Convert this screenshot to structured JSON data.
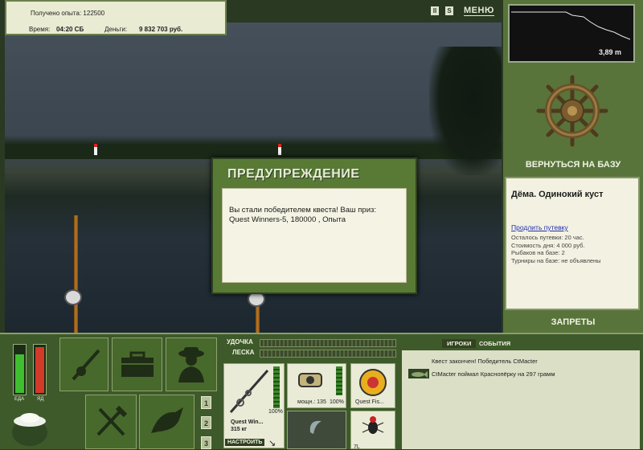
{
  "stats": {
    "experience_label": "Получено опыта:",
    "experience_value": "122500",
    "time_label": "Время:",
    "time_value": "04:20 СБ",
    "money_label": "Деньги:",
    "money_value": "9 832 703 руб."
  },
  "top_controls": {
    "pause_glyph": "II",
    "sound_glyph": "S",
    "menu_label": "МЕНЮ"
  },
  "depth": {
    "value": "3,89 m"
  },
  "base": {
    "return_label": "ВЕРНУТЬСЯ НА БАЗУ",
    "name": "Дёма. Одинокий куст",
    "extend_link": "Продлить путевку",
    "remaining": "Осталось путевки: 20 час.",
    "day_cost": "Стоимость дня: 4 000 руб.",
    "anglers": "Рыбаков на базе: 2",
    "tournaments": "Турниры на базе: не объявлены",
    "bans_label": "ЗАПРЕТЫ"
  },
  "dialog": {
    "title": "ПРЕДУПРЕЖДЕНИЕ",
    "message_line1": "Вы стали победителем квеста! Ваш приз:",
    "message_line2": "Quest Winners-5, 180000 , Опыта"
  },
  "meters": {
    "food_label": "ЕДА",
    "poison_label": "ЯД",
    "food_level": 0.8,
    "poison_level": 0.95
  },
  "slots": [
    "1",
    "2",
    "3"
  ],
  "tackle": {
    "rod_label": "УДОЧКА",
    "line_label": "ЛЕСКА",
    "rod_name": "Quest Win...",
    "rod_weight": "315 кг",
    "rod_condition": "100%",
    "setup_label": "НАСТРОИТЬ",
    "reel_power": "мощн.: 135",
    "reel_condition": "100%",
    "line_name": "Quest Fis...",
    "lure_level": "7L"
  },
  "events": {
    "tab_players": "ИГРОКИ",
    "tab_events": "СОБЫТИЯ",
    "items": [
      "Квест закончен! Победитель CtMacter",
      "CtMacter поймал Краснопёрку на 297 грамм"
    ]
  },
  "colors": {
    "panel_green": "#58743a",
    "bottom_green": "#3f5a2a",
    "dialog_green": "#587a35",
    "food_meter": "#3fbf2f",
    "poison_meter": "#d43a2a"
  }
}
